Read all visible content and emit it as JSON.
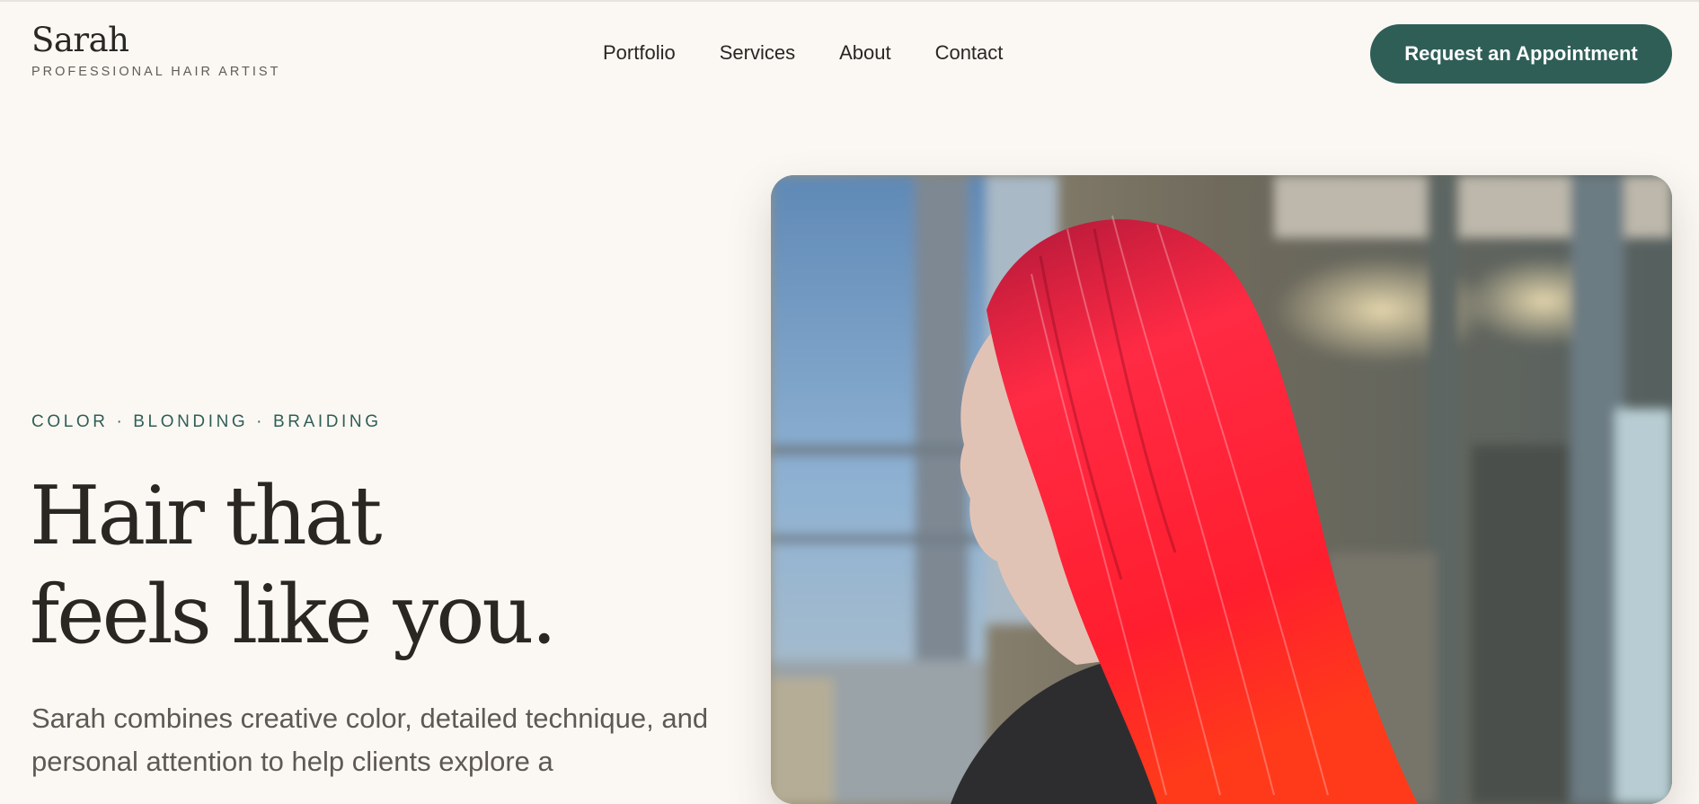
{
  "header": {
    "logo_name": "Sarah",
    "logo_tagline": "PROFESSIONAL HAIR ARTIST",
    "nav": [
      {
        "label": "Portfolio"
      },
      {
        "label": "Services"
      },
      {
        "label": "About"
      },
      {
        "label": "Contact"
      }
    ],
    "cta_label": "Request an Appointment"
  },
  "hero": {
    "eyebrow": "COLOR · BLONDING · BRAIDING",
    "headline_line1": "Hair that",
    "headline_line2": "feels like you.",
    "lede": "Sarah combines creative color, detailed technique, and personal attention to help clients explore a"
  },
  "colors": {
    "background": "#fbf8f4",
    "accent": "#2f5e57",
    "text": "#2a2622",
    "hair": "#ff1e3a"
  }
}
